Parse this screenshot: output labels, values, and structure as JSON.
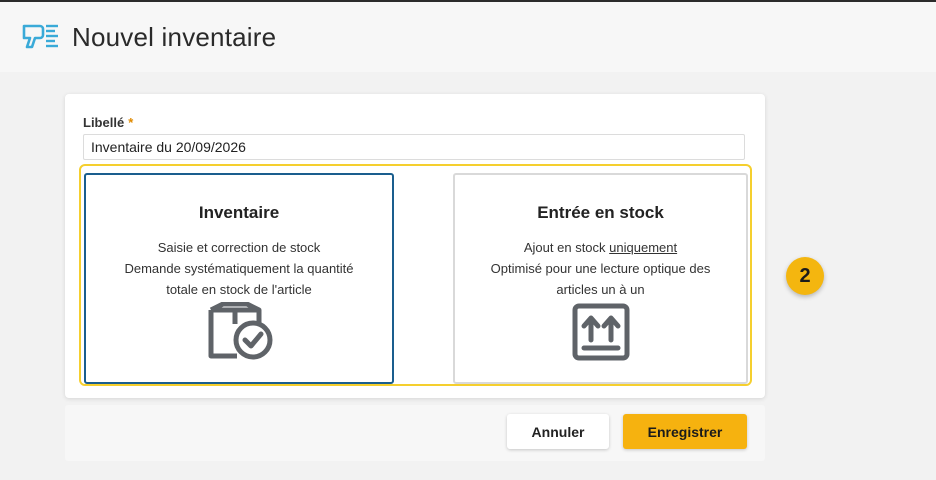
{
  "header": {
    "title": "Nouvel inventaire",
    "icon": "barcode-scanner-icon",
    "accent": "#3aaad8"
  },
  "form": {
    "label": "Libellé",
    "required_mark": "*",
    "value": "Inventaire du 20/09/2026"
  },
  "options": {
    "inventaire": {
      "title": "Inventaire",
      "line1": "Saisie et correction de stock",
      "line2": "Demande systématiquement la quantité",
      "line3": "totale en stock de l'article",
      "icon": "box-check-icon",
      "selected": true
    },
    "entree": {
      "title": "Entrée en stock",
      "line1_prefix": "Ajout en stock ",
      "line1_emphasis": "uniquement",
      "line2": "Optimisé pour une lecture optique des",
      "line3": "articles un à un",
      "icon": "box-arrows-up-icon",
      "selected": false
    }
  },
  "step_badge": "2",
  "footer": {
    "cancel_label": "Annuler",
    "save_label": "Enregistrer"
  },
  "colors": {
    "selected_border": "#1a5e8e",
    "group_highlight": "#f5cf2e",
    "primary_button": "#f6b20f"
  }
}
